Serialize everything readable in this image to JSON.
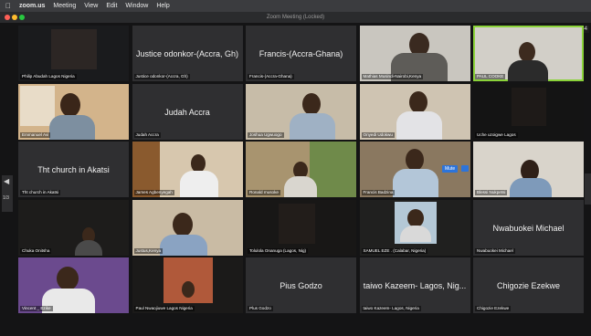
{
  "menubar": {
    "items": [
      "zoom.us",
      "Meeting",
      "View",
      "Edit",
      "Window",
      "Help"
    ]
  },
  "window": {
    "title": "Zoom Meeting (Locked)",
    "time": "01:44"
  },
  "pager": {
    "label": "1/3"
  },
  "mute_label": "Mute",
  "colors": {
    "active_speaker_border": "#8bd33a",
    "mute_button": "#2d74da"
  },
  "tiles": [
    {
      "name": "Philip Abudah Lagos Nigeria",
      "video": true
    },
    {
      "name": "Justice odonkor-(Accra, Gh)",
      "display": "Justice odonkor-(Accra, Gh)",
      "video": false
    },
    {
      "name": "Francis-(Accra-Ghana)",
      "display": "Francis-(Accra-Ghana)",
      "video": false
    },
    {
      "name": "Mathias Musindi-Nairobi,Kenya",
      "video": true
    },
    {
      "name": "PAUL COOKE",
      "video": true,
      "active": true
    },
    {
      "name": "Emmanuel Avi",
      "video": true
    },
    {
      "name": "Judah Accra",
      "display": "Judah Accra",
      "video": false
    },
    {
      "name": "Joshua Ugwuogo",
      "video": true
    },
    {
      "name": "Onyedi Udokwu",
      "video": true
    },
    {
      "name": "Uche uzoigwe Lagos",
      "video": true
    },
    {
      "name": "Tht church in Akatsi",
      "display": "Tht church in Akatsi",
      "video": false
    },
    {
      "name": "James Agbenyegah",
      "video": true
    },
    {
      "name": "Ronald musoke",
      "video": true
    },
    {
      "name": "Francis Badzina",
      "video": true
    },
    {
      "name": "Blessi Nukpetsi",
      "video": true
    },
    {
      "name": "Chuka Onitsha",
      "video": true
    },
    {
      "name": "Justus,Kenya",
      "video": true
    },
    {
      "name": "Tolulola Onanuga (Lagos, Nig)",
      "video": true
    },
    {
      "name": "SAMUEL EZE . (Calabar, Nigeria)",
      "video": true
    },
    {
      "name": "Nwabuokei Michael",
      "display": "Nwabuokei Michael",
      "video": false
    },
    {
      "name": "Vincent _ Ezike",
      "video": true
    },
    {
      "name": "Paul Nwaojiuwe Lagos Nigeria",
      "video": true
    },
    {
      "name": "Plus Godzo",
      "display": "Pius Godzo",
      "video": false
    },
    {
      "name": "taiwo Kazeem- Lagos, Nigeria",
      "display": "taiwo Kazeem- Lagos, Nig...",
      "video": false
    },
    {
      "name": "Chigozie Ezekwe",
      "display": "Chigozie Ezekwe",
      "video": false
    }
  ]
}
